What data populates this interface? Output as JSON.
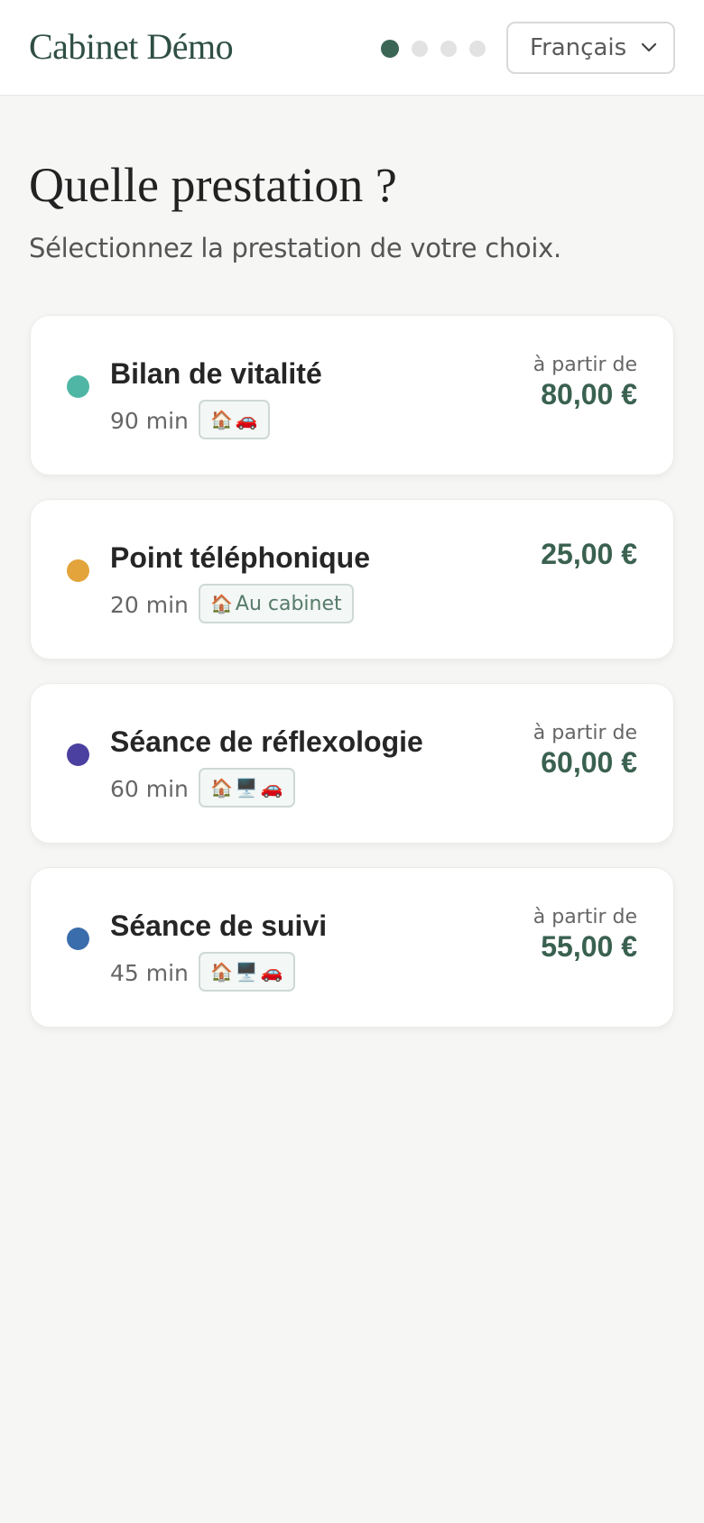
{
  "header": {
    "brand": "Cabinet Démo",
    "steps": [
      {
        "state": "active"
      },
      {
        "state": "inactive"
      },
      {
        "state": "inactive"
      },
      {
        "state": "inactive"
      }
    ],
    "language": {
      "selected": "Français",
      "icon": "chevron-down-icon"
    }
  },
  "main": {
    "title": "Quelle prestation ?",
    "subtitle": "Sélectionnez la prestation de votre choix."
  },
  "services": [
    {
      "name": "Bilan de vitalité",
      "duration": "90 min",
      "color": "#4fb6a5",
      "badge_icons": [
        "🏠",
        "🚗"
      ],
      "badge_text": "",
      "price_prefix": "à partir de",
      "price": "80,00 €"
    },
    {
      "name": "Point téléphonique",
      "duration": "20 min",
      "color": "#e2a43b",
      "badge_icons": [
        "🏠"
      ],
      "badge_text": "Au cabinet",
      "price_prefix": "",
      "price": "25,00 €"
    },
    {
      "name": "Séance de réflexologie",
      "duration": "60 min",
      "color": "#4b3fa0",
      "badge_icons": [
        "🏠",
        "🖥️",
        "🚗"
      ],
      "badge_text": "",
      "price_prefix": "à partir de",
      "price": "60,00 €"
    },
    {
      "name": "Séance de suivi",
      "duration": "45 min",
      "color": "#3a6dab",
      "badge_icons": [
        "🏠",
        "🖥️",
        "🚗"
      ],
      "badge_text": "",
      "price_prefix": "à partir de",
      "price": "55,00 €"
    }
  ],
  "colors": {
    "accent": "#3b6655",
    "price": "#3a6150",
    "background": "#f6f6f5"
  }
}
